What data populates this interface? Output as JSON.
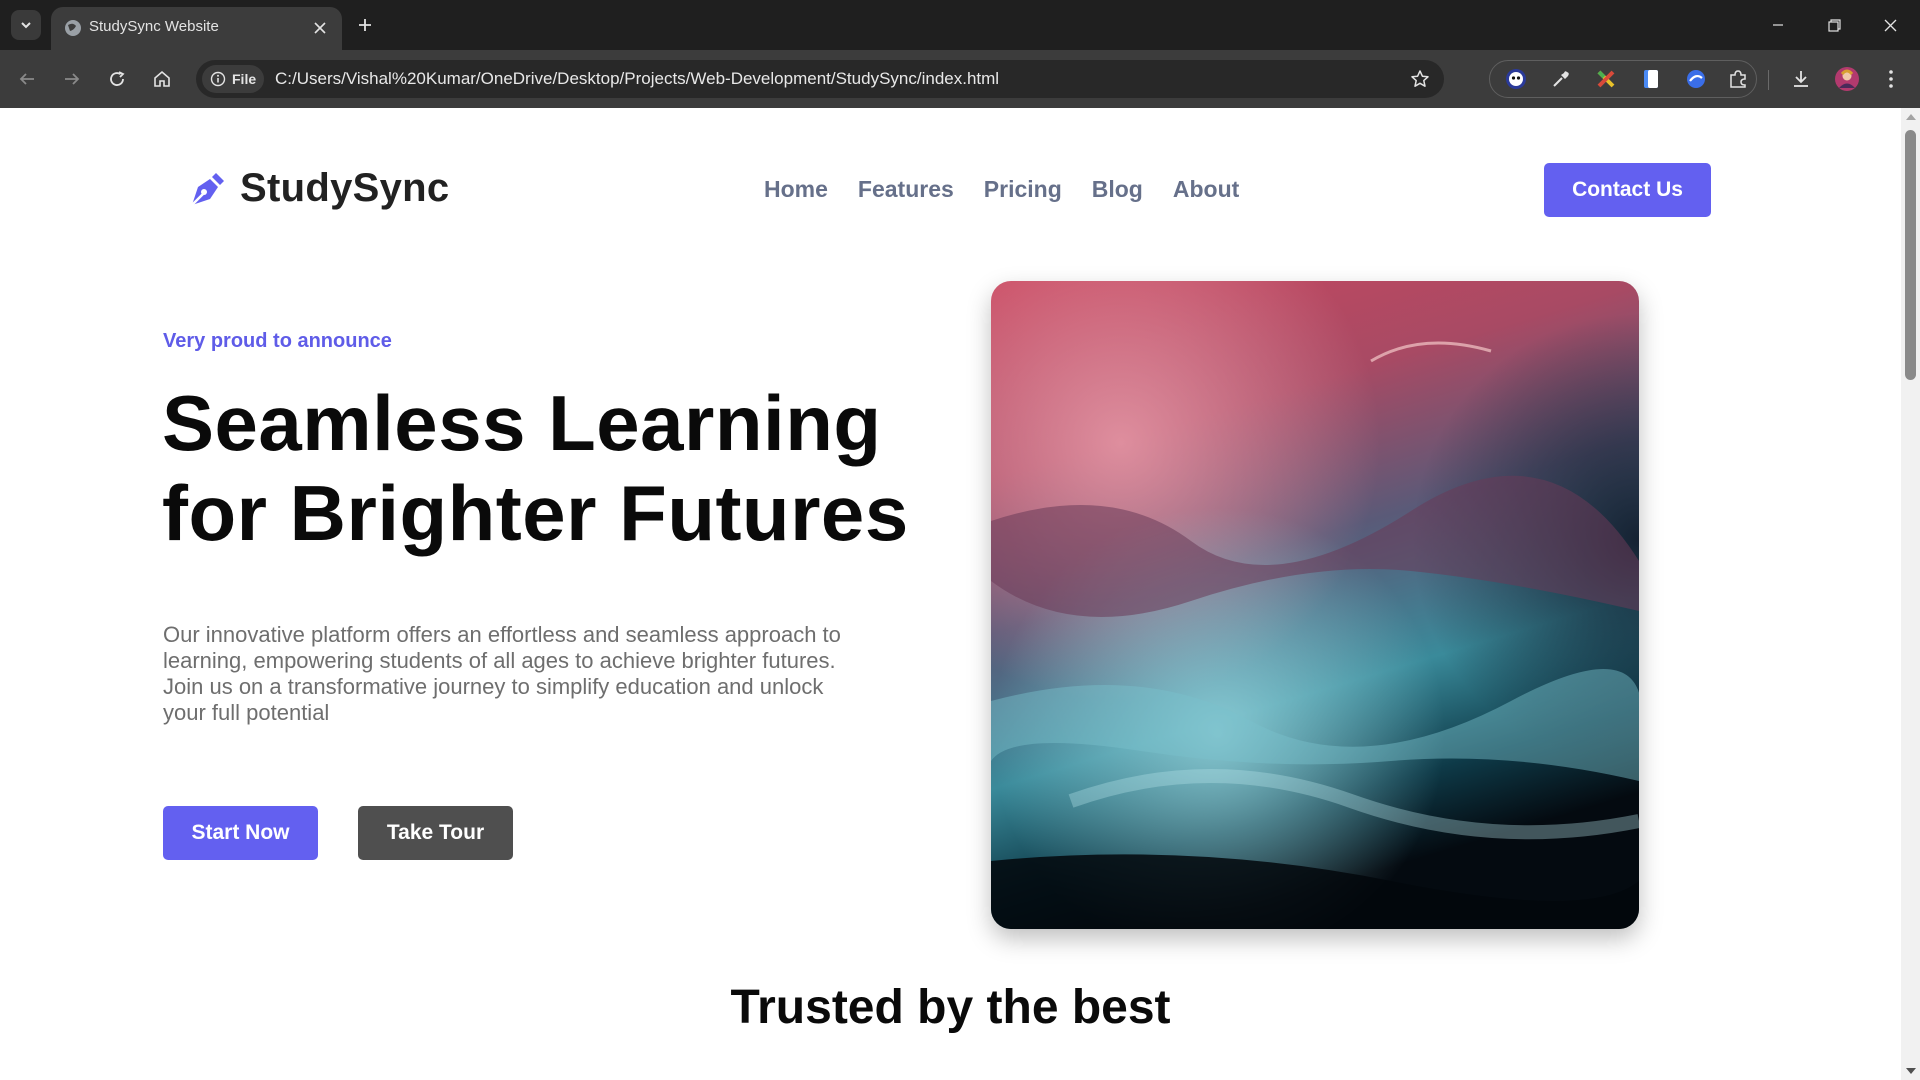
{
  "browser": {
    "tab_title": "StudySync Website",
    "url_scheme_label": "File",
    "url": "C:/Users/Vishal%20Kumar/OneDrive/Desktop/Projects/Web-Development/StudySync/index.html",
    "icons": [
      "tab-search-icon",
      "globe-icon",
      "close-icon",
      "plus-icon",
      "minimize-icon",
      "restore-icon",
      "window-close-icon",
      "back-icon",
      "forward-icon",
      "reload-icon",
      "home-icon",
      "info-icon",
      "bookmark-star-icon",
      "extension-icons",
      "download-icon",
      "profile-avatar",
      "menu-dots-icon"
    ]
  },
  "site": {
    "brand": "StudySync",
    "nav": [
      "Home",
      "Features",
      "Pricing",
      "Blog",
      "About"
    ],
    "contact_label": "Contact Us",
    "hero": {
      "eyebrow": "Very proud to announce",
      "headline_line1": "Seamless Learning",
      "headline_line2": "for Brighter Futures",
      "description": "Our innovative platform offers an effortless and seamless approach to learning, empowering students of all ages to achieve brighter futures. Join us on a transformative journey to simplify education and unlock your full potential",
      "primary_cta": "Start Now",
      "secondary_cta": "Take Tour"
    },
    "trusted_heading": "Trusted by the best"
  },
  "colors": {
    "accent": "#6360f0",
    "secondary_button": "#4f4f4f",
    "nav_text": "#66708a",
    "chrome_dark": "#1f1f1f"
  }
}
